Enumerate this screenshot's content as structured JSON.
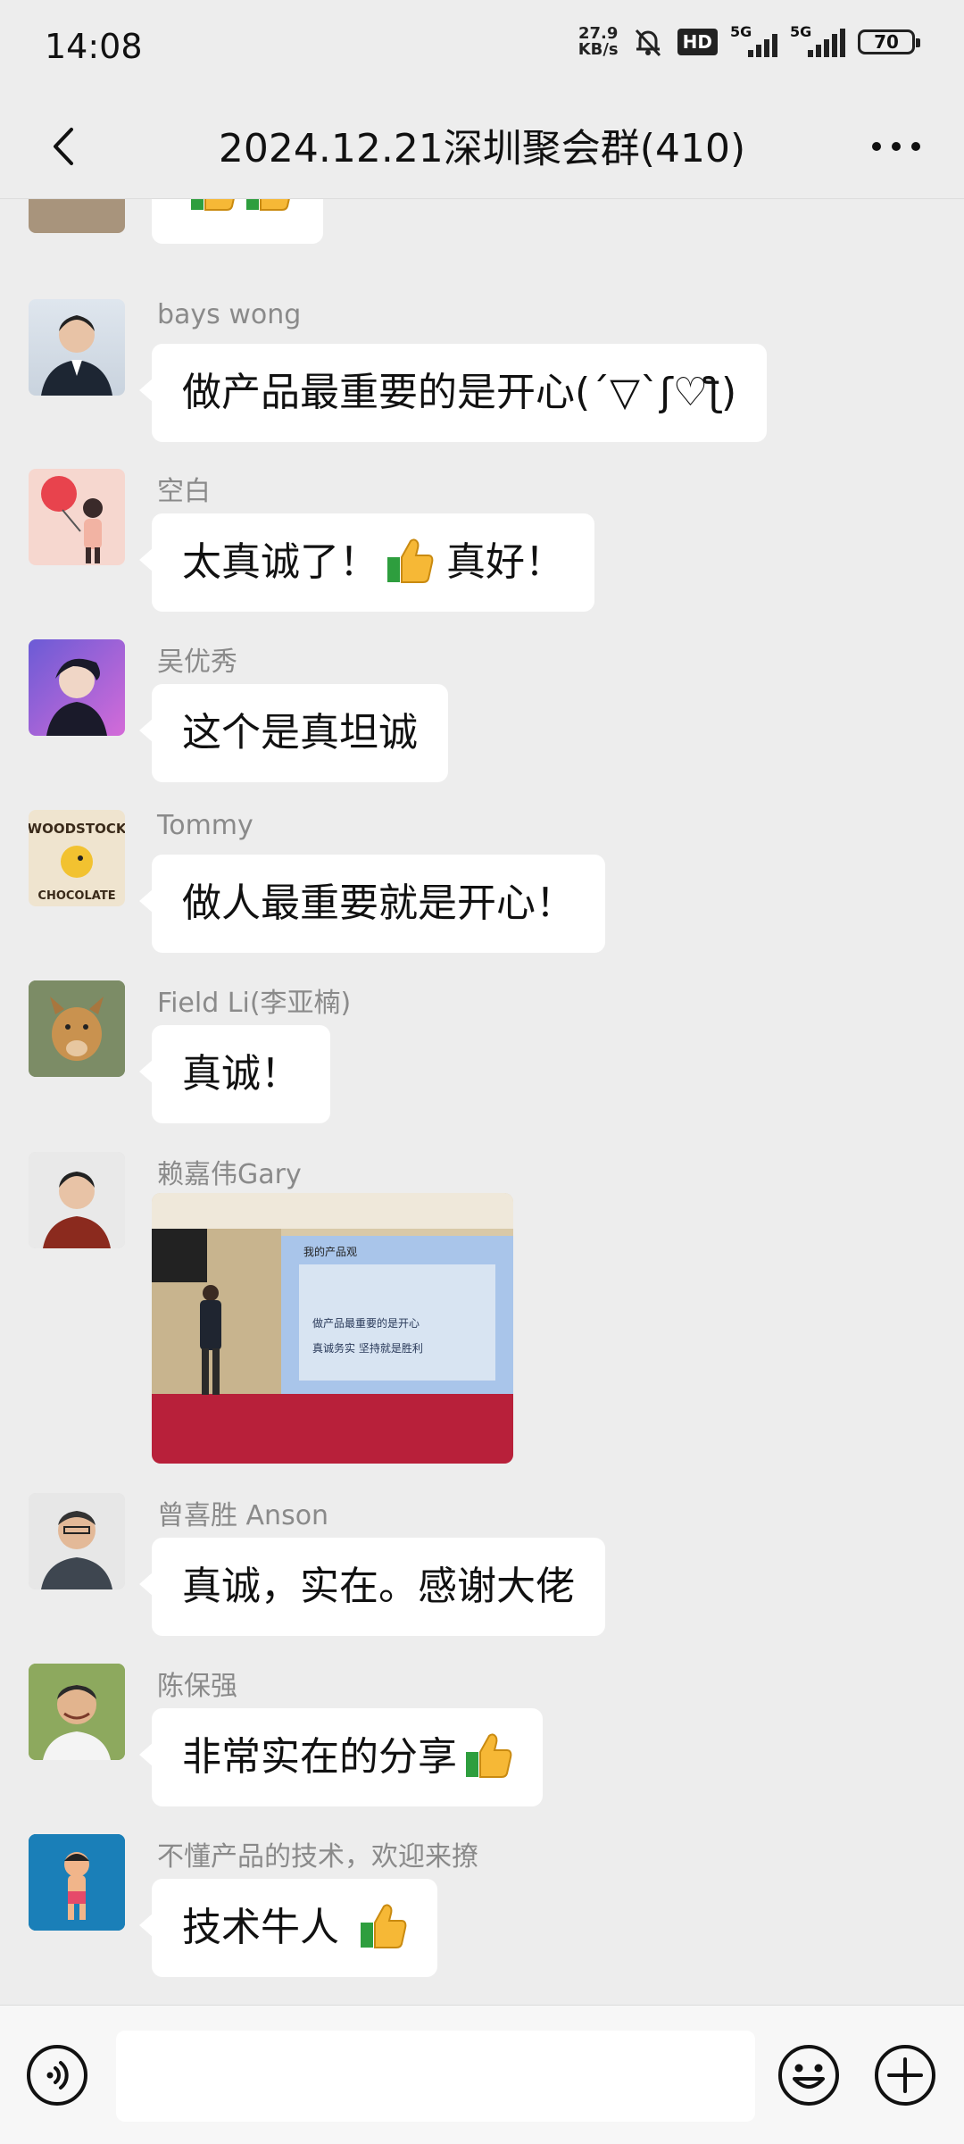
{
  "status_bar": {
    "time": "14:08",
    "net_speed_value": "27.9",
    "net_speed_unit": "KB/s",
    "hd_label": "HD",
    "signal1_label": "5G",
    "signal2_label": "5G",
    "battery": "70"
  },
  "header": {
    "title": "2024.12.21深圳聚会群(410)"
  },
  "messages": [
    {
      "name": "",
      "text": ""
    },
    {
      "name": "bays wong",
      "text": "做产品最重要的是开心(ˊ▽ˋʃ♡ƪ)"
    },
    {
      "name": "空白",
      "text": "太真诚了！",
      "text2": " 真好！"
    },
    {
      "name": "吴优秀",
      "text": "这个是真坦诚"
    },
    {
      "name": "Tommy",
      "text": "做人最重要就是开心！"
    },
    {
      "name": "Field Li(李亚楠)",
      "text": "真诚！"
    },
    {
      "name": "赖嘉伟Gary",
      "image_alt": "我的产品观",
      "image_caption_line1": "做产品最重要的是开心",
      "image_caption_line2": "真诚务实 坚持就是胜利"
    },
    {
      "name": "曾喜胜 Anson",
      "text": "真诚，实在。感谢大佬"
    },
    {
      "name": "陈保强",
      "text": "非常实在的分享"
    },
    {
      "name": "不懂产品的技术，欢迎来撩",
      "text": "技术牛人 "
    }
  ],
  "avatar_texts": {
    "tommy_line1": "WOODSTOCK",
    "tommy_line2": "CHOCOLATE"
  },
  "input": {
    "placeholder": ""
  },
  "icons": {
    "back": "chevron-left-icon",
    "more": "more-dots-icon",
    "voice": "voice-icon",
    "emoji": "emoji-icon",
    "plus": "plus-icon",
    "thumbs_up": "thumbs-up-emoji"
  }
}
